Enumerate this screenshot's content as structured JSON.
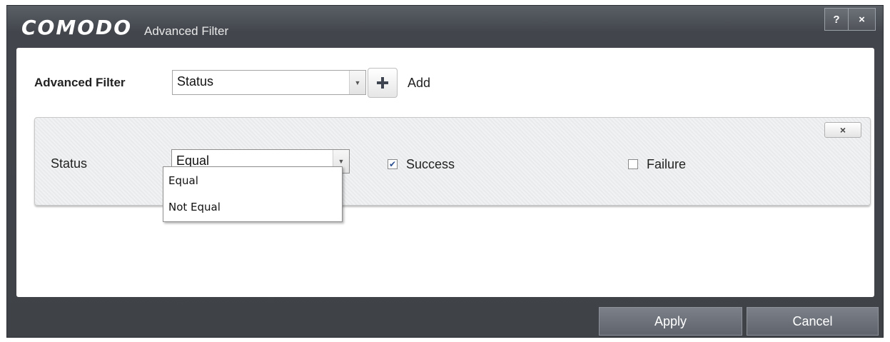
{
  "window": {
    "brand": "COMODO",
    "title": "Advanced Filter",
    "help_label": "?",
    "close_label": "×"
  },
  "toolbar": {
    "filter_label": "Advanced Filter",
    "filter_select_value": "Status",
    "add_label": "Add"
  },
  "filter_row": {
    "close_label": "×",
    "label": "Status",
    "operator_value": "Equal",
    "options": [
      {
        "label": "Success",
        "checked": true
      },
      {
        "label": "Failure",
        "checked": false
      }
    ]
  },
  "operator_dropdown": {
    "options": [
      "Equal",
      "Not Equal"
    ]
  },
  "footer": {
    "apply_label": "Apply",
    "cancel_label": "Cancel"
  },
  "icons": {
    "brand_logo": "comodo-wordmark",
    "add": "plus-icon",
    "dropdown_arrow": "chevron-down-icon",
    "checkmark": "check-icon",
    "close": "close-icon",
    "help": "help-icon"
  }
}
